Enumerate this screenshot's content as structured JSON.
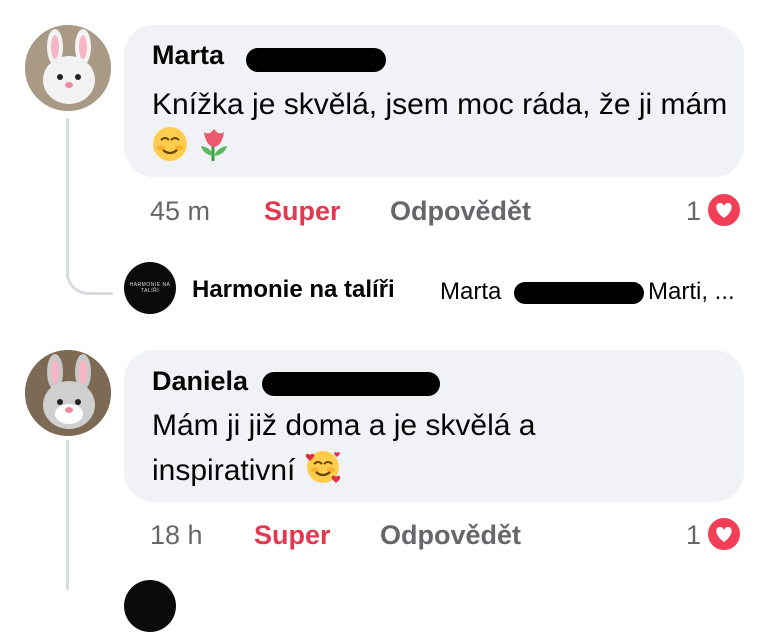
{
  "comments": [
    {
      "author": "Marta",
      "text": "Knížka je skvělá, jsem moc ráda, že ji mám",
      "time": "45 m",
      "reaction_label": "Super",
      "reply_label": "Odpovědět",
      "reaction_count": "1"
    },
    {
      "author": "Daniela",
      "text": "Mám ji již doma a je skvělá a inspirativní",
      "time": "18 h",
      "reaction_label": "Super",
      "reply_label": "Odpovědět",
      "reaction_count": "1"
    }
  ],
  "reply_preview": {
    "author": "Harmonie na talíři",
    "mention": "Marta",
    "text_tail": "Marti, ...",
    "avatar_text": "HARMONIE NA TALÍŘI"
  },
  "colors": {
    "reaction": "#e4384f",
    "heart": "#f33e58",
    "bubble": "#f0f2f5",
    "muted": "#65676b"
  },
  "icons": [
    "bunny-avatar-icon",
    "smiling-face-emoji",
    "tulip-emoji",
    "smiling-face-hearts-emoji",
    "heart-reaction-icon"
  ]
}
